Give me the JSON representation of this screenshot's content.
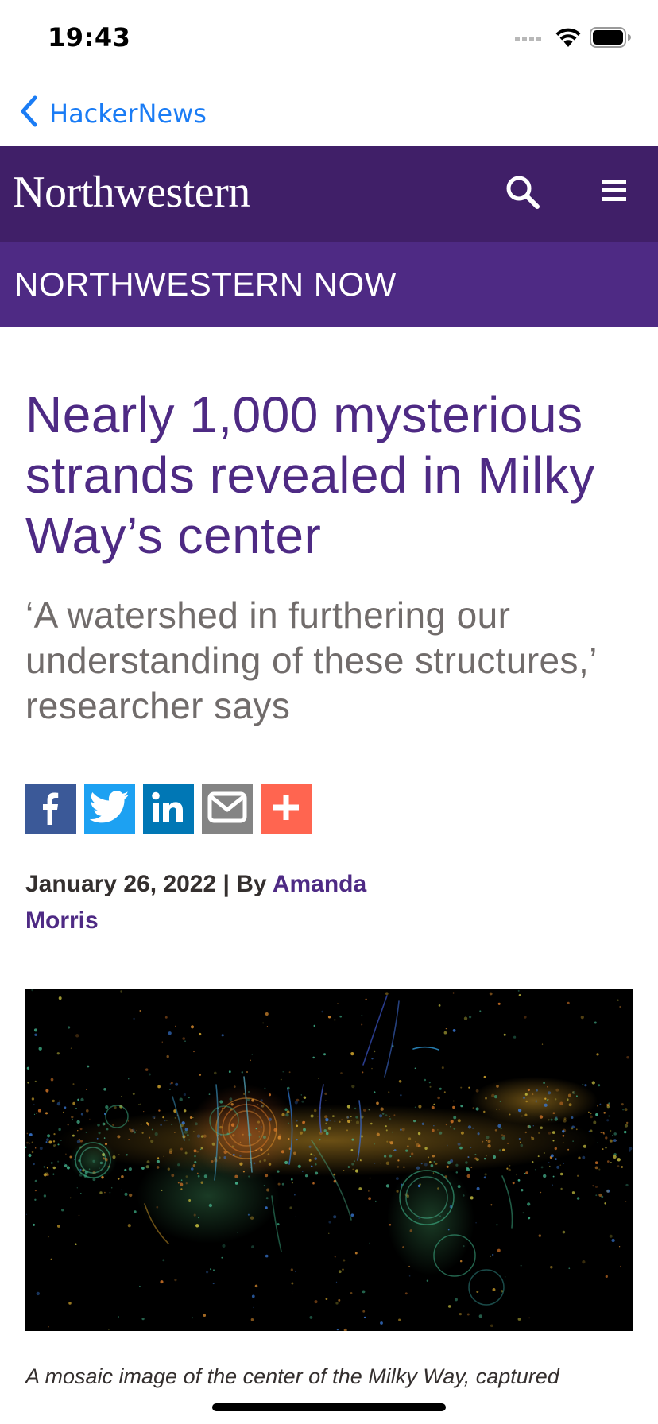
{
  "status_bar": {
    "time": "19:43",
    "icons": [
      "signal-icon",
      "wifi-icon",
      "battery-icon"
    ]
  },
  "navigation": {
    "back_label": "HackerNews",
    "back_icon": "chevron-left-icon",
    "accent_color": "#1a7cf5"
  },
  "header": {
    "logo_text": "Northwestern",
    "search_icon": "search-icon",
    "menu_icon": "hamburger-menu-icon",
    "background_color": "#401f68"
  },
  "section": {
    "title": "NORTHWESTERN NOW",
    "background_color": "#4e2a84"
  },
  "article": {
    "title": "Nearly 1,000 mysterious strands revealed in Milky Way’s center",
    "subtitle": "‘A watershed in furthering our understanding of these structures,’ researcher says",
    "date": "January 26, 2022",
    "byline_separator": " | By ",
    "author": "Amanda Morris",
    "caption": "A mosaic image of the center of the Milky Way, captured",
    "title_color": "#4e2a84"
  },
  "share": [
    {
      "name": "facebook-icon",
      "color": "#3b5998"
    },
    {
      "name": "twitter-icon",
      "color": "#1da1f2"
    },
    {
      "name": "linkedin-icon",
      "color": "#0077b5"
    },
    {
      "name": "email-icon",
      "color": "#848484"
    },
    {
      "name": "plus-icon",
      "color": "#ff6550"
    }
  ]
}
